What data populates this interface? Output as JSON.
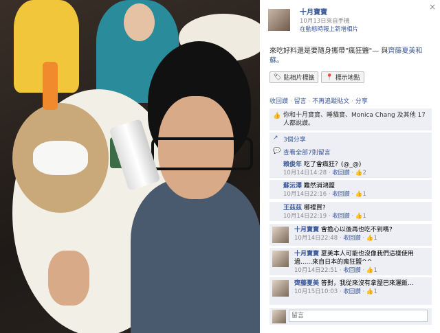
{
  "panel": {
    "close_label": "×",
    "poster": {
      "name": "十月寶寶",
      "date": "10月13日來自手機",
      "via": "在動態時報上新增相片"
    },
    "caption": {
      "text": "來吃好料還是要隨身攜帶\"瘋狂鹽\"— 與",
      "tagged": "齊藤夏美和蘇",
      "end": "。"
    },
    "buttons": [
      {
        "icon": "tag-icon",
        "label": "貼相片標籤"
      },
      {
        "icon": "location-pin-icon",
        "label": "標示地點"
      }
    ],
    "actions": [
      "收回讚",
      "留言",
      "不再追蹤貼文",
      "分享"
    ],
    "likes_text": "你和十月寶寶、睡貓寶、Monica Chang 及其他 17 人都說讚。",
    "shares_text": "3個分享",
    "all_comments_text": "查看全部7則留言",
    "comments": [
      {
        "name": "賴俊年",
        "text": "吃了會瘋狂？(@_@)",
        "time": "10月14日14:28",
        "unlike": "收回讚",
        "likes": "2"
      },
      {
        "name": "蘇沄澤",
        "text": "難然消鴻鹽",
        "time": "10月14日22:16",
        "unlike": "收回讚",
        "likes": "1"
      },
      {
        "name": "王茲茲",
        "text": "哪裡買?",
        "time": "10月14日22:19",
        "unlike": "收回讚",
        "likes": "1"
      },
      {
        "name": "十月寶寶",
        "text": "會擔心以後再也吃不到嗎?",
        "time": "10月14日22:48",
        "unlike": "收回讚",
        "likes": "1"
      },
      {
        "name": "十月寶寶",
        "text": "夏美本人可能也沒像我們這樣使用過......來自日本的瘋狂鹽^^",
        "time": "10月14日22:51",
        "unlike": "收回讚",
        "likes": "1"
      },
      {
        "name": "齊藤夏美",
        "text": "答對，我從來沒有拿鹽巴來灑飯...",
        "time": "10月15日10:03",
        "unlike": "收回讚",
        "likes": "1"
      }
    ],
    "reply_placeholder": "留言"
  }
}
